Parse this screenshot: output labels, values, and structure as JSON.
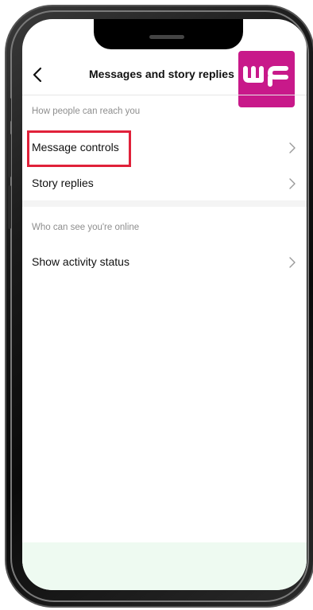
{
  "header": {
    "title": "Messages and story replies",
    "back_icon": "chevron-left-icon"
  },
  "logo": {
    "text": "۳۴",
    "color": "#c8198a"
  },
  "sections": [
    {
      "label": "How people can reach you",
      "items": [
        {
          "label": "Message controls",
          "icon": "chevron-right-icon",
          "highlighted": true
        },
        {
          "label": "Story replies",
          "icon": "chevron-right-icon"
        }
      ]
    },
    {
      "label": "Who can see you're online",
      "items": [
        {
          "label": "Show activity status",
          "icon": "chevron-right-icon"
        }
      ]
    }
  ],
  "colors": {
    "highlight": "#e0213a",
    "section_label": "#8e8e8e",
    "bottom_bar": "#eefaf1"
  }
}
